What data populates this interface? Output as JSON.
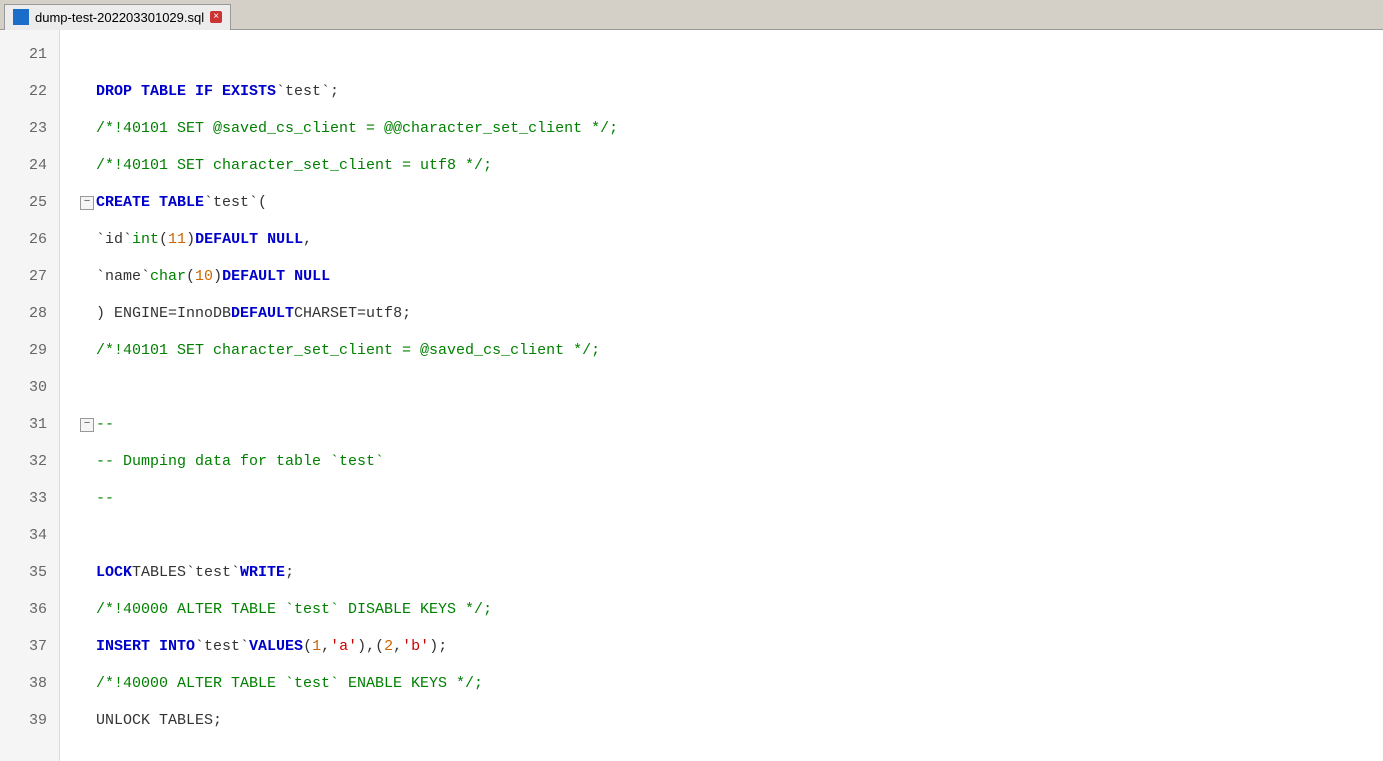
{
  "tab": {
    "icon_label": "sql-file-icon",
    "title": "dump-test-202203301029.sql",
    "close_label": "×"
  },
  "lines": [
    {
      "num": 21,
      "fold": "",
      "tokens": []
    },
    {
      "num": 22,
      "fold": "",
      "tokens": [
        {
          "type": "kw-blue",
          "text": "DROP TABLE IF EXISTS"
        },
        {
          "type": "plain",
          "text": " "
        },
        {
          "type": "backtick",
          "text": "`test`"
        },
        {
          "type": "plain",
          "text": ";"
        }
      ]
    },
    {
      "num": 23,
      "fold": "",
      "tokens": [
        {
          "type": "comment",
          "text": "/*!40101 SET @saved_cs_client    = @@character_set_client */;"
        }
      ]
    },
    {
      "num": 24,
      "fold": "",
      "tokens": [
        {
          "type": "comment",
          "text": "/*!40101 SET character_set_client = utf8 */;"
        }
      ]
    },
    {
      "num": 25,
      "fold": "−",
      "tokens": [
        {
          "type": "kw-blue",
          "text": "CREATE TABLE"
        },
        {
          "type": "plain",
          "text": " "
        },
        {
          "type": "backtick",
          "text": "`test`"
        },
        {
          "type": "plain",
          "text": " ("
        }
      ]
    },
    {
      "num": 26,
      "fold": "",
      "tokens": [
        {
          "type": "plain",
          "text": "    "
        },
        {
          "type": "backtick",
          "text": "`id`"
        },
        {
          "type": "plain",
          "text": " "
        },
        {
          "type": "kw-green",
          "text": "int"
        },
        {
          "type": "plain",
          "text": "("
        },
        {
          "type": "number-val",
          "text": "11"
        },
        {
          "type": "plain",
          "text": ") "
        },
        {
          "type": "kw-blue",
          "text": "DEFAULT NULL"
        },
        {
          "type": "plain",
          "text": ","
        }
      ]
    },
    {
      "num": 27,
      "fold": "",
      "tokens": [
        {
          "type": "plain",
          "text": "    "
        },
        {
          "type": "backtick",
          "text": "`name`"
        },
        {
          "type": "plain",
          "text": " "
        },
        {
          "type": "kw-green",
          "text": "char"
        },
        {
          "type": "plain",
          "text": "("
        },
        {
          "type": "number-val",
          "text": "10"
        },
        {
          "type": "plain",
          "text": ") "
        },
        {
          "type": "kw-blue",
          "text": "DEFAULT NULL"
        }
      ]
    },
    {
      "num": 28,
      "fold": "",
      "tokens": [
        {
          "type": "plain",
          "text": ") ENGINE=InnoDB "
        },
        {
          "type": "kw-blue",
          "text": "DEFAULT"
        },
        {
          "type": "plain",
          "text": " CHARSET=utf8;"
        }
      ]
    },
    {
      "num": 29,
      "fold": "",
      "tokens": [
        {
          "type": "comment",
          "text": "/*!40101 SET character_set_client = @saved_cs_client */;"
        }
      ]
    },
    {
      "num": 30,
      "fold": "",
      "tokens": []
    },
    {
      "num": 31,
      "fold": "−",
      "tokens": [
        {
          "type": "comment",
          "text": "--"
        }
      ]
    },
    {
      "num": 32,
      "fold": "",
      "tokens": [
        {
          "type": "comment",
          "text": "-- Dumping data for table `test`"
        }
      ]
    },
    {
      "num": 33,
      "fold": "",
      "tokens": [
        {
          "type": "comment",
          "text": "--"
        }
      ]
    },
    {
      "num": 34,
      "fold": "",
      "tokens": []
    },
    {
      "num": 35,
      "fold": "",
      "tokens": [
        {
          "type": "plain",
          "text": "    "
        },
        {
          "type": "kw-blue",
          "text": "LOCK"
        },
        {
          "type": "plain",
          "text": " TABLES "
        },
        {
          "type": "backtick",
          "text": "`test`"
        },
        {
          "type": "plain",
          "text": " "
        },
        {
          "type": "kw-blue",
          "text": "WRITE"
        },
        {
          "type": "plain",
          "text": ";"
        }
      ]
    },
    {
      "num": 36,
      "fold": "",
      "tokens": [
        {
          "type": "comment",
          "text": "/*!40000 ALTER TABLE `test` DISABLE KEYS */;"
        }
      ]
    },
    {
      "num": 37,
      "fold": "",
      "tokens": [
        {
          "type": "plain",
          "text": "    "
        },
        {
          "type": "kw-blue",
          "text": "INSERT INTO"
        },
        {
          "type": "plain",
          "text": " "
        },
        {
          "type": "backtick",
          "text": "`test`"
        },
        {
          "type": "plain",
          "text": " "
        },
        {
          "type": "kw-blue",
          "text": "VALUES"
        },
        {
          "type": "plain",
          "text": " ("
        },
        {
          "type": "number-val",
          "text": "1"
        },
        {
          "type": "plain",
          "text": ","
        },
        {
          "type": "string-val",
          "text": "'a'"
        },
        {
          "type": "plain",
          "text": "),("
        },
        {
          "type": "number-val",
          "text": "2"
        },
        {
          "type": "plain",
          "text": ","
        },
        {
          "type": "string-val",
          "text": "'b'"
        },
        {
          "type": "plain",
          "text": ");"
        }
      ]
    },
    {
      "num": 38,
      "fold": "",
      "tokens": [
        {
          "type": "comment",
          "text": "/*!40000 ALTER TABLE `test` ENABLE KEYS */;"
        }
      ]
    },
    {
      "num": 39,
      "fold": "",
      "tokens": [
        {
          "type": "plain",
          "text": "    UNLOCK TABLES;"
        }
      ]
    }
  ]
}
